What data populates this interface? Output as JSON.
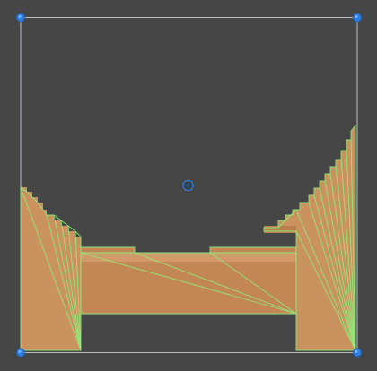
{
  "editor": {
    "background_color": "#464646",
    "frame_color": "#b9bfc8",
    "handle_color": "#2f7fe0",
    "pivot_color": "#2c4f78",
    "sprite_color": "#c9925f",
    "sprite_dark": "#b97f4e",
    "sprite_light": "#d8a678",
    "wire_color": "#8ff07a",
    "icons": {
      "handles": "corner-resize-handle",
      "pivot": "pivot-handle"
    }
  }
}
